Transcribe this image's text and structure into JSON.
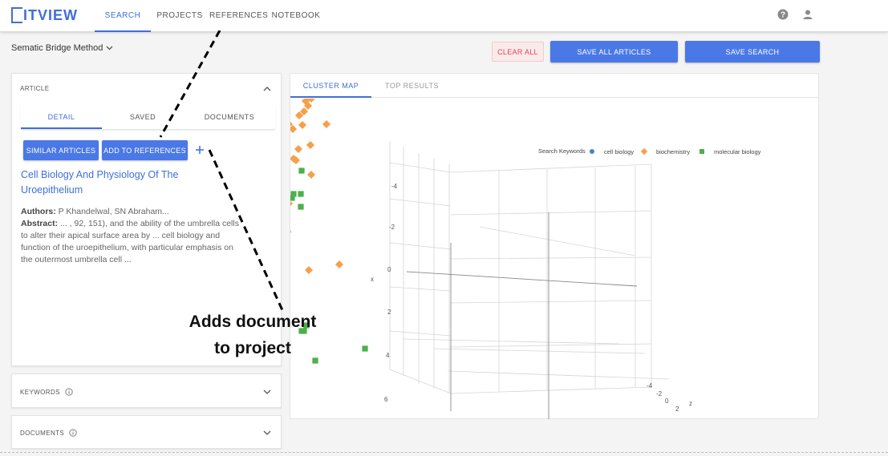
{
  "app": {
    "logo_text": "ITVIEW",
    "nav_tabs": [
      {
        "label": "SEARCH",
        "active": true
      },
      {
        "label": "PROJECTS",
        "active": false
      },
      {
        "label": "REFERENCES",
        "active": false
      },
      {
        "label": "NOTEBOOK",
        "active": false
      }
    ],
    "help_icon": "help-circle-icon",
    "user_icon": "user-icon",
    "accent_color": "#3f6fd8"
  },
  "toolbar": {
    "search_method": "Sematic Bridge Method",
    "clear_label": "CLEAR ALL",
    "save_articles_label": "SAVE ALL ARTICLES",
    "save_search_label": "SAVE SEARCH"
  },
  "article_panel": {
    "header": "ARTICLE",
    "tabs": [
      "DETAIL",
      "SAVED",
      "DOCUMENTS"
    ],
    "similar_label": "SIMILAR ARTICLES",
    "add_ref_label": "ADD TO REFERENCES",
    "add_icon": "plus-icon",
    "title": "Cell Biology And Physiology Of The Uroepithelium",
    "authors_label": "Authors:",
    "authors": "P Khandelwal, SN Abraham...",
    "abstract_label": "Abstract:",
    "abstract": "... , 92, 151), and the ability of the umbrella cells to alter their apical surface area by ... cell biology and function of the uroepithelium, with particular emphasis on the outermost umbrella cell ..."
  },
  "keywords_panel": {
    "header": "KEYWORDS",
    "info_icon": "info-icon"
  },
  "documents_panel": {
    "header": "DOCUMENTS",
    "info_icon": "info-icon"
  },
  "results": {
    "tabs": [
      {
        "label": "CLUSTER MAP",
        "active": true
      },
      {
        "label": "TOP RESULTS",
        "active": false
      }
    ]
  },
  "annotation": {
    "line1": "Adds document",
    "line2": "to project"
  },
  "chart_data": {
    "type": "scatter",
    "title": "",
    "legend_title": "Search Keywords",
    "legend_position": "top-right",
    "series": [
      {
        "name": "cell biology",
        "color": "#3f86c6",
        "marker": "circle"
      },
      {
        "name": "biochemistry",
        "color": "#f5a04a",
        "marker": "diamond"
      },
      {
        "name": "molecular biology",
        "color": "#4db04a",
        "marker": "square"
      }
    ],
    "axes": {
      "x": {
        "label": "x",
        "ticks": [
          "-4",
          "-2",
          "0",
          "2",
          "4",
          "6"
        ]
      },
      "z": {
        "label": "z",
        "ticks": [
          "-4",
          "-2",
          "0",
          "2"
        ]
      }
    },
    "grid": true
  }
}
